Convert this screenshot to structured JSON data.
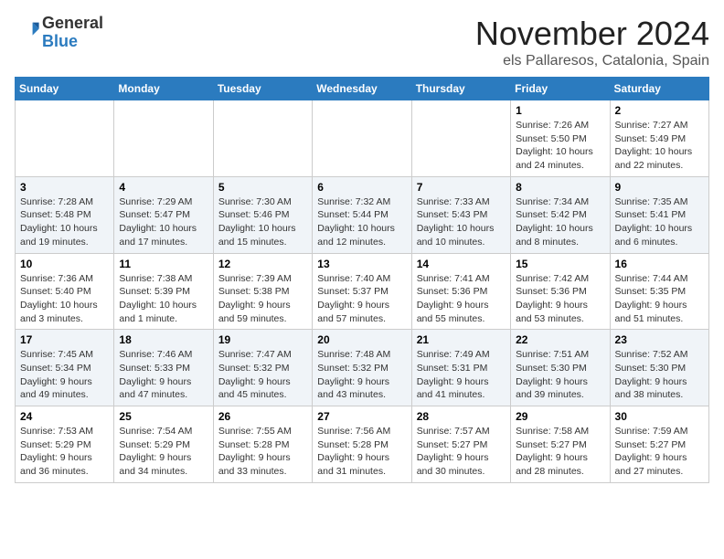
{
  "header": {
    "logo": {
      "line1": "General",
      "line2": "Blue"
    },
    "title": "November 2024",
    "location": "els Pallaresos, Catalonia, Spain"
  },
  "weekdays": [
    "Sunday",
    "Monday",
    "Tuesday",
    "Wednesday",
    "Thursday",
    "Friday",
    "Saturday"
  ],
  "weeks": [
    [
      {
        "day": "",
        "info": ""
      },
      {
        "day": "",
        "info": ""
      },
      {
        "day": "",
        "info": ""
      },
      {
        "day": "",
        "info": ""
      },
      {
        "day": "",
        "info": ""
      },
      {
        "day": "1",
        "info": "Sunrise: 7:26 AM\nSunset: 5:50 PM\nDaylight: 10 hours and 24 minutes."
      },
      {
        "day": "2",
        "info": "Sunrise: 7:27 AM\nSunset: 5:49 PM\nDaylight: 10 hours and 22 minutes."
      }
    ],
    [
      {
        "day": "3",
        "info": "Sunrise: 7:28 AM\nSunset: 5:48 PM\nDaylight: 10 hours and 19 minutes."
      },
      {
        "day": "4",
        "info": "Sunrise: 7:29 AM\nSunset: 5:47 PM\nDaylight: 10 hours and 17 minutes."
      },
      {
        "day": "5",
        "info": "Sunrise: 7:30 AM\nSunset: 5:46 PM\nDaylight: 10 hours and 15 minutes."
      },
      {
        "day": "6",
        "info": "Sunrise: 7:32 AM\nSunset: 5:44 PM\nDaylight: 10 hours and 12 minutes."
      },
      {
        "day": "7",
        "info": "Sunrise: 7:33 AM\nSunset: 5:43 PM\nDaylight: 10 hours and 10 minutes."
      },
      {
        "day": "8",
        "info": "Sunrise: 7:34 AM\nSunset: 5:42 PM\nDaylight: 10 hours and 8 minutes."
      },
      {
        "day": "9",
        "info": "Sunrise: 7:35 AM\nSunset: 5:41 PM\nDaylight: 10 hours and 6 minutes."
      }
    ],
    [
      {
        "day": "10",
        "info": "Sunrise: 7:36 AM\nSunset: 5:40 PM\nDaylight: 10 hours and 3 minutes."
      },
      {
        "day": "11",
        "info": "Sunrise: 7:38 AM\nSunset: 5:39 PM\nDaylight: 10 hours and 1 minute."
      },
      {
        "day": "12",
        "info": "Sunrise: 7:39 AM\nSunset: 5:38 PM\nDaylight: 9 hours and 59 minutes."
      },
      {
        "day": "13",
        "info": "Sunrise: 7:40 AM\nSunset: 5:37 PM\nDaylight: 9 hours and 57 minutes."
      },
      {
        "day": "14",
        "info": "Sunrise: 7:41 AM\nSunset: 5:36 PM\nDaylight: 9 hours and 55 minutes."
      },
      {
        "day": "15",
        "info": "Sunrise: 7:42 AM\nSunset: 5:36 PM\nDaylight: 9 hours and 53 minutes."
      },
      {
        "day": "16",
        "info": "Sunrise: 7:44 AM\nSunset: 5:35 PM\nDaylight: 9 hours and 51 minutes."
      }
    ],
    [
      {
        "day": "17",
        "info": "Sunrise: 7:45 AM\nSunset: 5:34 PM\nDaylight: 9 hours and 49 minutes."
      },
      {
        "day": "18",
        "info": "Sunrise: 7:46 AM\nSunset: 5:33 PM\nDaylight: 9 hours and 47 minutes."
      },
      {
        "day": "19",
        "info": "Sunrise: 7:47 AM\nSunset: 5:32 PM\nDaylight: 9 hours and 45 minutes."
      },
      {
        "day": "20",
        "info": "Sunrise: 7:48 AM\nSunset: 5:32 PM\nDaylight: 9 hours and 43 minutes."
      },
      {
        "day": "21",
        "info": "Sunrise: 7:49 AM\nSunset: 5:31 PM\nDaylight: 9 hours and 41 minutes."
      },
      {
        "day": "22",
        "info": "Sunrise: 7:51 AM\nSunset: 5:30 PM\nDaylight: 9 hours and 39 minutes."
      },
      {
        "day": "23",
        "info": "Sunrise: 7:52 AM\nSunset: 5:30 PM\nDaylight: 9 hours and 38 minutes."
      }
    ],
    [
      {
        "day": "24",
        "info": "Sunrise: 7:53 AM\nSunset: 5:29 PM\nDaylight: 9 hours and 36 minutes."
      },
      {
        "day": "25",
        "info": "Sunrise: 7:54 AM\nSunset: 5:29 PM\nDaylight: 9 hours and 34 minutes."
      },
      {
        "day": "26",
        "info": "Sunrise: 7:55 AM\nSunset: 5:28 PM\nDaylight: 9 hours and 33 minutes."
      },
      {
        "day": "27",
        "info": "Sunrise: 7:56 AM\nSunset: 5:28 PM\nDaylight: 9 hours and 31 minutes."
      },
      {
        "day": "28",
        "info": "Sunrise: 7:57 AM\nSunset: 5:27 PM\nDaylight: 9 hours and 30 minutes."
      },
      {
        "day": "29",
        "info": "Sunrise: 7:58 AM\nSunset: 5:27 PM\nDaylight: 9 hours and 28 minutes."
      },
      {
        "day": "30",
        "info": "Sunrise: 7:59 AM\nSunset: 5:27 PM\nDaylight: 9 hours and 27 minutes."
      }
    ]
  ]
}
